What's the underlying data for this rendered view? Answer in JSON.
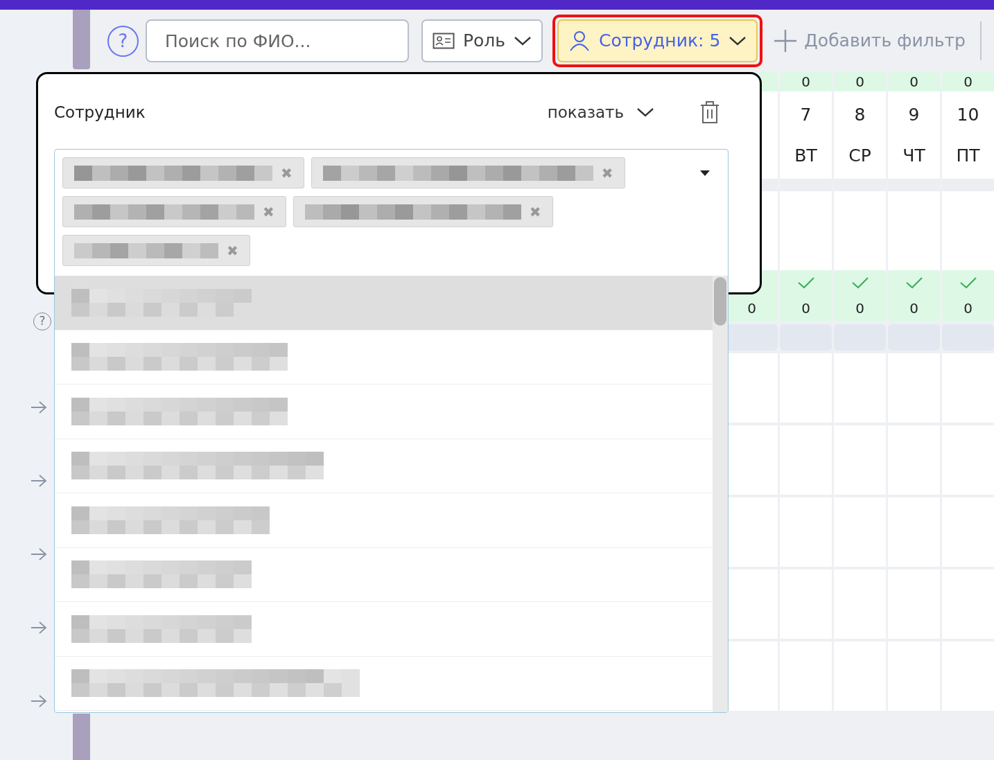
{
  "toolbar": {
    "help": "?",
    "search": {
      "placeholder": "Поиск по ФИО..."
    },
    "filters": [
      {
        "kind": "role",
        "label": "Роль",
        "active": false
      },
      {
        "kind": "person",
        "label": "Сотрудник: 5",
        "active": true
      }
    ],
    "add_filter": "Добавить фильтр"
  },
  "calendar": {
    "totals": [
      "0",
      "0",
      "0",
      "0"
    ],
    "days": [
      {
        "number": "7",
        "weekday": "ВТ"
      },
      {
        "number": "8",
        "weekday": "СР"
      },
      {
        "number": "9",
        "weekday": "ЧТ"
      },
      {
        "number": "10",
        "weekday": "ПТ"
      }
    ],
    "partial_count": "0",
    "marks": [
      {
        "checked": true,
        "count": "0"
      },
      {
        "checked": true,
        "count": "0"
      },
      {
        "checked": true,
        "count": "0"
      },
      {
        "checked": true,
        "count": "0"
      }
    ]
  },
  "sidebar": {
    "help": "?"
  },
  "filter_popup": {
    "title": "Сотрудник",
    "mode": "показать",
    "chips": [
      {
        "remove": "✖"
      },
      {
        "remove": "✖"
      },
      {
        "remove": "✖"
      },
      {
        "remove": "✖"
      },
      {
        "remove": "✖"
      }
    ],
    "options": [
      {
        "highlighted": true
      },
      {
        "highlighted": false
      },
      {
        "highlighted": false
      },
      {
        "highlighted": false
      },
      {
        "highlighted": false
      },
      {
        "highlighted": false
      },
      {
        "highlighted": false
      },
      {
        "highlighted": false
      }
    ]
  }
}
